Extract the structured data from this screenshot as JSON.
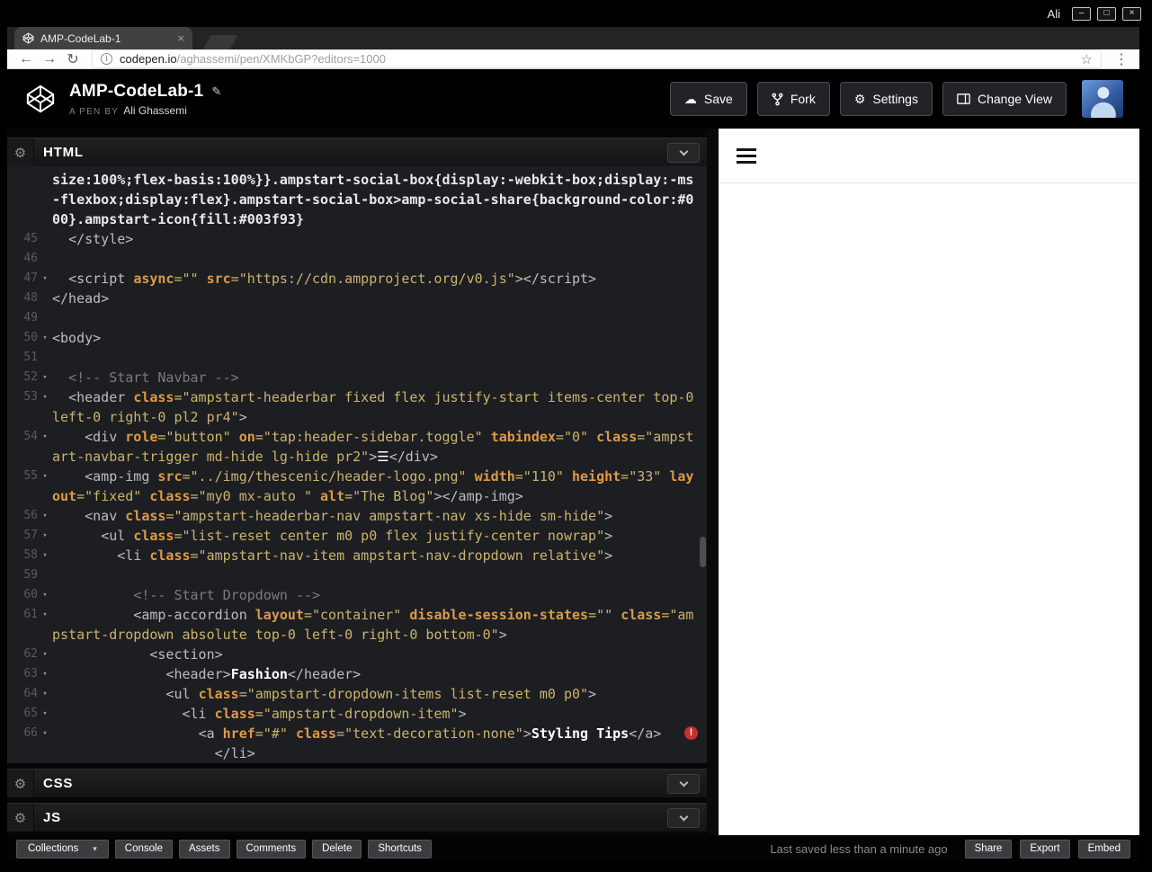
{
  "desktop": {
    "user_label": "Ali"
  },
  "browser": {
    "tab_title": "AMP-CodeLab-1",
    "url_domain": "codepen.io",
    "url_path": "/aghassemi/pen/XMKbGP?editors=1000"
  },
  "pen": {
    "title": "AMP-CodeLab-1",
    "byline_label": "A PEN BY",
    "author": "Ali Ghassemi",
    "actions": {
      "save": "Save",
      "fork": "Fork",
      "settings": "Settings",
      "change_view": "Change View"
    }
  },
  "panels": {
    "html": "HTML",
    "css": "CSS",
    "js": "JS"
  },
  "icons": {
    "gear": "⚙",
    "cloud": "☁",
    "pencil": "✎",
    "star": "☆",
    "menu_dots": "⋮",
    "back": "←",
    "forward": "→",
    "reload": "↻",
    "caret_down": "▾",
    "fold": "▾",
    "close": "×",
    "minimize": "–",
    "maximize": "□",
    "info": "i",
    "error": "!"
  },
  "colors": {
    "code_background": "#1d1e22",
    "error_red": "#c9302c",
    "string_gold": "#cbb36d",
    "attr_orange": "#dd9a46"
  },
  "code": {
    "lines": [
      {
        "num": "",
        "fold": false,
        "tokens": [
          [
            "css",
            "size:100%;flex-basis:100%}}.ampstart-social-box{display:-webkit-box;display:-ms-flexbox;display:flex}.ampstart-social-box>amp-social-share{background-color:#000}.ampstart-icon{fill:#003f93}"
          ]
        ]
      },
      {
        "num": "45",
        "fold": false,
        "tokens": [
          [
            "tag",
            "  </style>"
          ]
        ]
      },
      {
        "num": "46",
        "fold": false,
        "tokens": []
      },
      {
        "num": "47",
        "fold": true,
        "tokens": [
          [
            "tag",
            "  <script "
          ],
          [
            "attr",
            "async"
          ],
          [
            "str",
            "=\"\" "
          ],
          [
            "attr",
            "src"
          ],
          [
            "str",
            "=\"https://cdn.ampproject.org/v0.js\""
          ],
          [
            "tag",
            "></script>"
          ]
        ]
      },
      {
        "num": "48",
        "fold": false,
        "tokens": [
          [
            "tag",
            "</head>"
          ]
        ]
      },
      {
        "num": "49",
        "fold": false,
        "tokens": []
      },
      {
        "num": "50",
        "fold": true,
        "tokens": [
          [
            "tag",
            "<body>"
          ]
        ]
      },
      {
        "num": "51",
        "fold": false,
        "tokens": []
      },
      {
        "num": "52",
        "fold": true,
        "tokens": [
          [
            "comment",
            "  <!-- Start Navbar -->"
          ]
        ]
      },
      {
        "num": "53",
        "fold": true,
        "tokens": [
          [
            "tag",
            "  <header "
          ],
          [
            "attr",
            "class"
          ],
          [
            "str",
            "=\"ampstart-headerbar fixed flex justify-start items-center top-0 left-0 right-0 pl2 pr4\""
          ],
          [
            "tag",
            ">"
          ]
        ]
      },
      {
        "num": "54",
        "fold": true,
        "tokens": [
          [
            "tag",
            "    <div "
          ],
          [
            "attr",
            "role"
          ],
          [
            "str",
            "=\"button\" "
          ],
          [
            "attr",
            "on"
          ],
          [
            "str",
            "=\"tap:header-sidebar.toggle\" "
          ],
          [
            "attr",
            "tabindex"
          ],
          [
            "str",
            "=\"0\" "
          ],
          [
            "attr",
            "class"
          ],
          [
            "str",
            "=\"ampstart-navbar-trigger md-hide lg-hide pr2\""
          ],
          [
            "tag",
            ">"
          ],
          [
            "text",
            "☰"
          ],
          [
            "tag",
            "</div>"
          ]
        ]
      },
      {
        "num": "55",
        "fold": true,
        "tokens": [
          [
            "tag",
            "    <amp-img "
          ],
          [
            "attr",
            "src"
          ],
          [
            "str",
            "=\"../img/thescenic/header-logo.png\" "
          ],
          [
            "attr",
            "width"
          ],
          [
            "str",
            "=\"110\" "
          ],
          [
            "attr",
            "height"
          ],
          [
            "str",
            "=\"33\" "
          ],
          [
            "attr",
            "layout"
          ],
          [
            "str",
            "=\"fixed\" "
          ],
          [
            "attr",
            "class"
          ],
          [
            "str",
            "=\"my0 mx-auto \" "
          ],
          [
            "attr",
            "alt"
          ],
          [
            "str",
            "=\"The Blog\""
          ],
          [
            "tag",
            "></amp-img>"
          ]
        ]
      },
      {
        "num": "56",
        "fold": true,
        "tokens": [
          [
            "tag",
            "    <nav "
          ],
          [
            "attr",
            "class"
          ],
          [
            "str",
            "=\"ampstart-headerbar-nav ampstart-nav xs-hide sm-hide\""
          ],
          [
            "tag",
            ">"
          ]
        ]
      },
      {
        "num": "57",
        "fold": true,
        "tokens": [
          [
            "tag",
            "      <ul "
          ],
          [
            "attr",
            "class"
          ],
          [
            "str",
            "=\"list-reset center m0 p0 flex justify-center nowrap\""
          ],
          [
            "tag",
            ">"
          ]
        ]
      },
      {
        "num": "58",
        "fold": true,
        "tokens": [
          [
            "tag",
            "        <li "
          ],
          [
            "attr",
            "class"
          ],
          [
            "str",
            "=\"ampstart-nav-item ampstart-nav-dropdown relative\""
          ],
          [
            "tag",
            ">"
          ]
        ]
      },
      {
        "num": "59",
        "fold": false,
        "tokens": []
      },
      {
        "num": "60",
        "fold": true,
        "tokens": [
          [
            "comment",
            "          <!-- Start Dropdown -->"
          ]
        ]
      },
      {
        "num": "61",
        "fold": true,
        "tokens": [
          [
            "tag",
            "          <amp-accordion "
          ],
          [
            "attr",
            "layout"
          ],
          [
            "str",
            "=\"container\" "
          ],
          [
            "attr",
            "disable-session-states"
          ],
          [
            "str",
            "=\"\" "
          ],
          [
            "attr",
            "class"
          ],
          [
            "str",
            "=\"ampstart-dropdown absolute top-0 left-0 right-0 bottom-0\""
          ],
          [
            "tag",
            ">"
          ]
        ]
      },
      {
        "num": "62",
        "fold": true,
        "tokens": [
          [
            "tag",
            "            <section>"
          ]
        ]
      },
      {
        "num": "63",
        "fold": true,
        "tokens": [
          [
            "tag",
            "              <header>"
          ],
          [
            "text",
            "Fashion"
          ],
          [
            "tag",
            "</header>"
          ]
        ]
      },
      {
        "num": "64",
        "fold": true,
        "tokens": [
          [
            "tag",
            "              <ul "
          ],
          [
            "attr",
            "class"
          ],
          [
            "str",
            "=\"ampstart-dropdown-items list-reset m0 p0\""
          ],
          [
            "tag",
            ">"
          ]
        ]
      },
      {
        "num": "65",
        "fold": true,
        "tokens": [
          [
            "tag",
            "                <li "
          ],
          [
            "attr",
            "class"
          ],
          [
            "str",
            "=\"ampstart-dropdown-item\""
          ],
          [
            "tag",
            ">"
          ]
        ]
      },
      {
        "num": "66",
        "fold": true,
        "error": true,
        "tokens": [
          [
            "tag",
            "                  <a "
          ],
          [
            "attr",
            "href"
          ],
          [
            "str",
            "=\"#\" "
          ],
          [
            "attr",
            "class"
          ],
          [
            "str",
            "=\"text-decoration-none\""
          ],
          [
            "tag",
            ">"
          ],
          [
            "text",
            "Styling Tips"
          ],
          [
            "tag",
            "</a>"
          ]
        ]
      },
      {
        "num": "",
        "fold": false,
        "tokens": [
          [
            "tag",
            "                    </li>"
          ]
        ]
      }
    ]
  },
  "footer": {
    "collections_label": "Collections",
    "left_buttons": [
      "Console",
      "Assets",
      "Comments",
      "Delete",
      "Shortcuts"
    ],
    "status": "Last saved less than a minute ago",
    "right_buttons": [
      "Share",
      "Export",
      "Embed"
    ]
  }
}
